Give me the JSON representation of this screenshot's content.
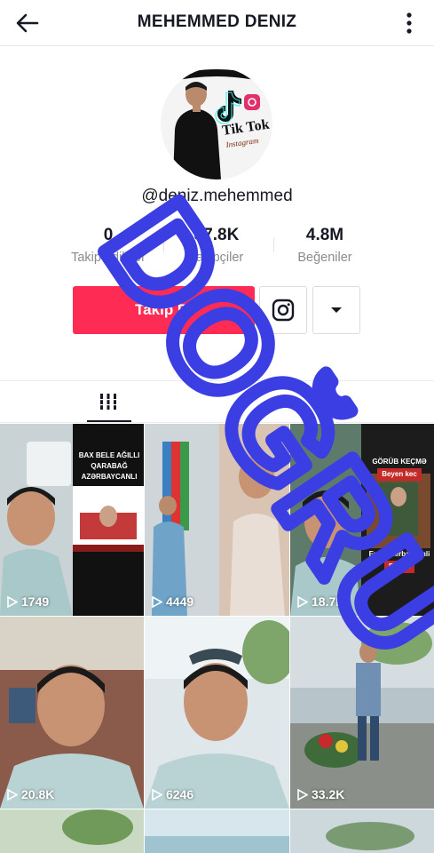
{
  "header": {
    "title": "MEHEMMED DENIZ"
  },
  "profile": {
    "handle": "@deniz.mehemmed",
    "avatar_logo_text": "Tik Tok",
    "avatar_logo_sub": "Instagram"
  },
  "stats": [
    {
      "value": "0",
      "label": "Takip ediliyor"
    },
    {
      "value": "87.8K",
      "label": "Takipçiler"
    },
    {
      "value": "4.8M",
      "label": "Beğeniler"
    }
  ],
  "actions": {
    "follow_label": "Takip Et"
  },
  "videos": [
    {
      "views": "1749",
      "caption_lines": [
        "BAX BELE AĞILLI",
        "QARABAĞ",
        "AZƏRBAYCANLI"
      ]
    },
    {
      "views": "4449",
      "caption_lines": []
    },
    {
      "views": "18.7K",
      "caption_lines": [
        "GÖRÜB KEÇMƏ",
        "Beyen kec",
        "Eyer Azerbaycanli",
        "Beyen"
      ]
    },
    {
      "views": "20.8K",
      "caption_lines": []
    },
    {
      "views": "6246",
      "caption_lines": []
    },
    {
      "views": "33.2K",
      "caption_lines": []
    }
  ],
  "watermark": {
    "text": "DOĞRU",
    "color": "#3b3fe3"
  },
  "colors": {
    "accent": "#fe2c55",
    "text": "#161823",
    "muted": "#8a8b91"
  }
}
